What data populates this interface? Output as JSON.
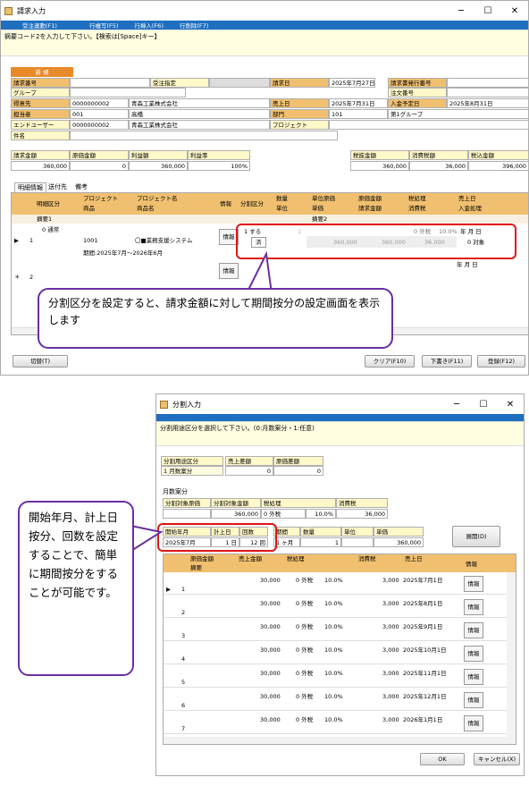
{
  "top": {
    "title": "請求入力",
    "menu": [
      "",
      "受注連動(F1)",
      "",
      "行複写(F5)",
      "行挿入(F6)",
      "行削除(F7)"
    ],
    "message": "摘要コード2を入力して下さい。【検索は[Space]キー】",
    "status_new": "新 規",
    "rows": {
      "seikyu_no": "請求番号",
      "juchu": "受注指定",
      "seikyu_bi": "請求日",
      "seikyu_bi_val": "2025年7月27日",
      "hakko_no": "請求書発行番号",
      "group": "グループ",
      "chumon_no": "注文番号",
      "tokui": "得意先",
      "tokui_code": "0000000002",
      "tokui_name": "青森工業株式会社",
      "uriage_bi": "売上日",
      "uriage_bi_val": "2025年7月31日",
      "nyukin_bi": "入金予定日",
      "nyukin_bi_val": "2025年8月31日",
      "tanto": "担当者",
      "tanto_code": "001",
      "tanto_name": "高橋",
      "bumon": "部門",
      "bumon_code": "101",
      "bumon_name": "第1グループ",
      "enduser": "エンドユーザー",
      "enduser_code": "0000000002",
      "enduser_name": "青森工業株式会社",
      "project": "プロジェクト",
      "kenmei": "件名"
    },
    "summary_labels": [
      "請求金額",
      "原価金額",
      "利益額",
      "利益率"
    ],
    "summary_values": [
      "360,000",
      "0",
      "360,000",
      "100%"
    ],
    "tax_labels": [
      "税抜金額",
      "消費税額",
      "税込金額"
    ],
    "tax_values": [
      "360,000",
      "36,000",
      "396,000"
    ],
    "tabs": [
      "明細情報",
      "送付先",
      "備考"
    ],
    "grid_h1": [
      "明細区分",
      "プロジェクト",
      "プロジェクト名",
      "情報",
      "分割区分",
      "数量",
      "単位原価",
      "原価金額",
      "税処理",
      "売上日"
    ],
    "grid_h2": [
      "",
      "商品",
      "商品名",
      "",
      "",
      "単位",
      "単価",
      "請求金額",
      "消費税",
      "入金処理"
    ],
    "row_tekiyo": "摘要1",
    "row_tekiyo2": "摘要2",
    "row1": {
      "no": "1",
      "kubun": "0 通常",
      "shohin": "1001",
      "shohin_name": "〇■業務支援システム",
      "info": "情報",
      "bunkatsu": "1 する",
      "bunkatsu2": "済",
      "qty": "1",
      "genka": "360,000",
      "kingaku": "360,000",
      "tax": "36,000",
      "zei": "0 外税",
      "rate": "10.0%",
      "uribi": "年 月 日",
      "nyukin": "0 対象",
      "kikan": "期間:2025年7月～2026年6月"
    },
    "row2": {
      "marker": "＊",
      "no": "2",
      "info": "情報",
      "uribi": "年 月 日"
    },
    "btn_kirikae": "切替(T)",
    "btn_clear": "クリア(F10)",
    "btn_draft": "下書き(F11)",
    "btn_register": "登録(F12)",
    "callout": "分割区分を設定すると、請求金額に対して期間按分の設定画面を表示します"
  },
  "bottom": {
    "title": "分割入力",
    "message": "分割用途区分を選択して下さい。(0:月数案分・1:任意)",
    "yoto_label": "分割用途区分",
    "yoto_value": "1 月数案分",
    "uriage_sagaku": "売上差額",
    "genka_sagaku": "原価差額",
    "uriage_sagaku_val": "0",
    "genka_sagaku_val": "0",
    "section": "月数案分",
    "labels1": [
      "分割対象原価",
      "分割対象金額",
      "税処理",
      "消費税"
    ],
    "values1": [
      "",
      "360,000",
      "0 外税",
      "10.0%",
      "36,000"
    ],
    "labels2": [
      "開始年月",
      "計上日",
      "回数",
      "期間",
      "数量",
      "単位",
      "単価"
    ],
    "values2": [
      "2025年7月",
      "1 日",
      "12 回",
      "1 ヶ月",
      "1",
      "",
      "360,000"
    ],
    "btn_tenkai": "展開(D)",
    "grid_h1": [
      "原価金額",
      "売上金額",
      "税処理",
      "消費税",
      "売上日",
      "情報"
    ],
    "grid_h2": "摘要",
    "rows": [
      {
        "no": "1",
        "amount": "30,000",
        "zei": "0 外税",
        "rate": "10.0%",
        "tax": "3,000",
        "date": "2025年7月1日"
      },
      {
        "no": "2",
        "amount": "30,000",
        "zei": "0 外税",
        "rate": "10.0%",
        "tax": "3,000",
        "date": "2025年8月1日"
      },
      {
        "no": "3",
        "amount": "30,000",
        "zei": "0 外税",
        "rate": "10.0%",
        "tax": "3,000",
        "date": "2025年9月1日"
      },
      {
        "no": "4",
        "amount": "30,000",
        "zei": "0 外税",
        "rate": "10.0%",
        "tax": "3,000",
        "date": "2025年10月1日"
      },
      {
        "no": "5",
        "amount": "30,000",
        "zei": "0 外税",
        "rate": "10.0%",
        "tax": "3,000",
        "date": "2025年11月1日"
      },
      {
        "no": "6",
        "amount": "30,000",
        "zei": "0 外税",
        "rate": "10.0%",
        "tax": "3,000",
        "date": "2025年12月1日"
      },
      {
        "no": "7",
        "amount": "30,000",
        "zei": "0 外税",
        "rate": "10.0%",
        "tax": "3,000",
        "date": "2026年1月1日"
      }
    ],
    "info": "情報",
    "btn_ok": "OK",
    "btn_cancel": "キャンセル(X)",
    "callout": "開始年月、計上日按分、回数を設定することで、簡単に期間按分をすることが可能です。"
  }
}
